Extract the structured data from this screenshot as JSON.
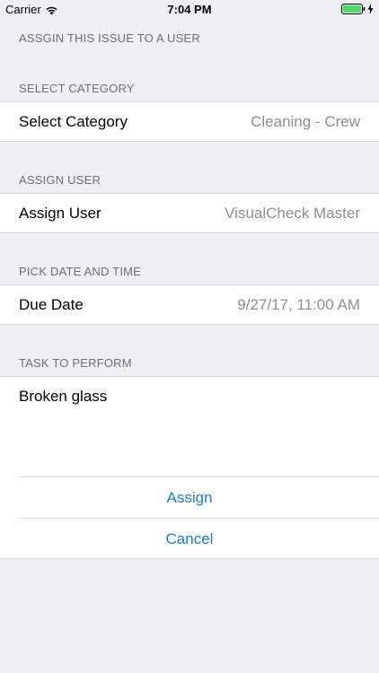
{
  "status_bar": {
    "carrier": "Carrier",
    "time": "7:04 PM",
    "battery_color": "#4cd964"
  },
  "page_header": "ASSGIN THIS ISSUE TO A USER",
  "sections": {
    "category": {
      "header": "SELECT CATEGORY",
      "label": "Select Category",
      "value": "Cleaning - Crew"
    },
    "user": {
      "header": "ASSIGN USER",
      "label": "Assign User",
      "value": "VisualCheck Master"
    },
    "date": {
      "header": "PICK DATE AND TIME",
      "label": "Due Date",
      "value": "9/27/17, 11:00 AM"
    },
    "task": {
      "header": "TASK TO PERFORM",
      "text": "Broken glass"
    }
  },
  "actions": {
    "assign_label": "Assign",
    "cancel_label": "Cancel"
  },
  "colors": {
    "accent": "#1a7fd1",
    "background": "#efeff4",
    "secondary_text": "#8e8e93"
  }
}
